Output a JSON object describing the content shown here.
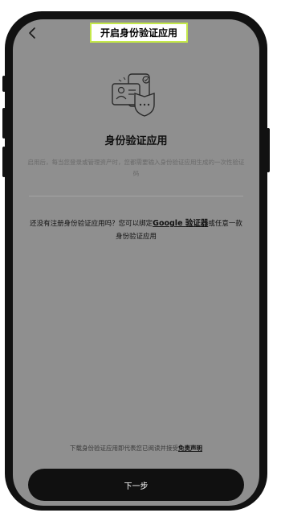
{
  "header": {
    "title": "开启身份验证应用"
  },
  "hero": {
    "icon": "authenticator-shield-icon",
    "title": "身份验证应用",
    "description": "启用后，每当您登录或管理资产时，您都需要输入身份验证应用生成的一次性验证码"
  },
  "register": {
    "prefix": "还没有注册身份验证应用吗？您可以绑定",
    "link": "Google 验证器",
    "suffix": "或任意一款身份验证应用"
  },
  "footer": {
    "disclaimer_prefix": "下载身份验证应用即代表您已阅读并接受",
    "disclaimer_link": "免责声明",
    "next_label": "下一步"
  },
  "colors": {
    "overlay": "#8f8f8f",
    "button": "#101010",
    "highlight_border": "#c4e84a"
  }
}
